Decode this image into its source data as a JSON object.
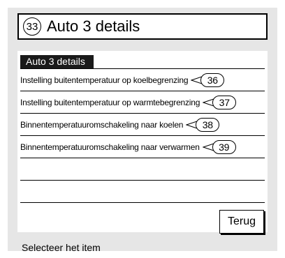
{
  "header": {
    "number": "33",
    "title": "Auto 3 details"
  },
  "section": {
    "tab_label": "Auto 3 details"
  },
  "items": [
    {
      "label": "Instelling buitentemperatuur op koelbegrenzing",
      "ref": "36"
    },
    {
      "label": "Instelling buitentemperatuur op warmtebegrenzing",
      "ref": "37"
    },
    {
      "label": "Binnentemperatuuromschakeling naar koelen",
      "ref": "38"
    },
    {
      "label": "Binnentemperatuuromschakeling naar verwarmen",
      "ref": "39"
    }
  ],
  "buttons": {
    "back_label": "Terug"
  },
  "status": {
    "text": "Selecteer het item"
  }
}
